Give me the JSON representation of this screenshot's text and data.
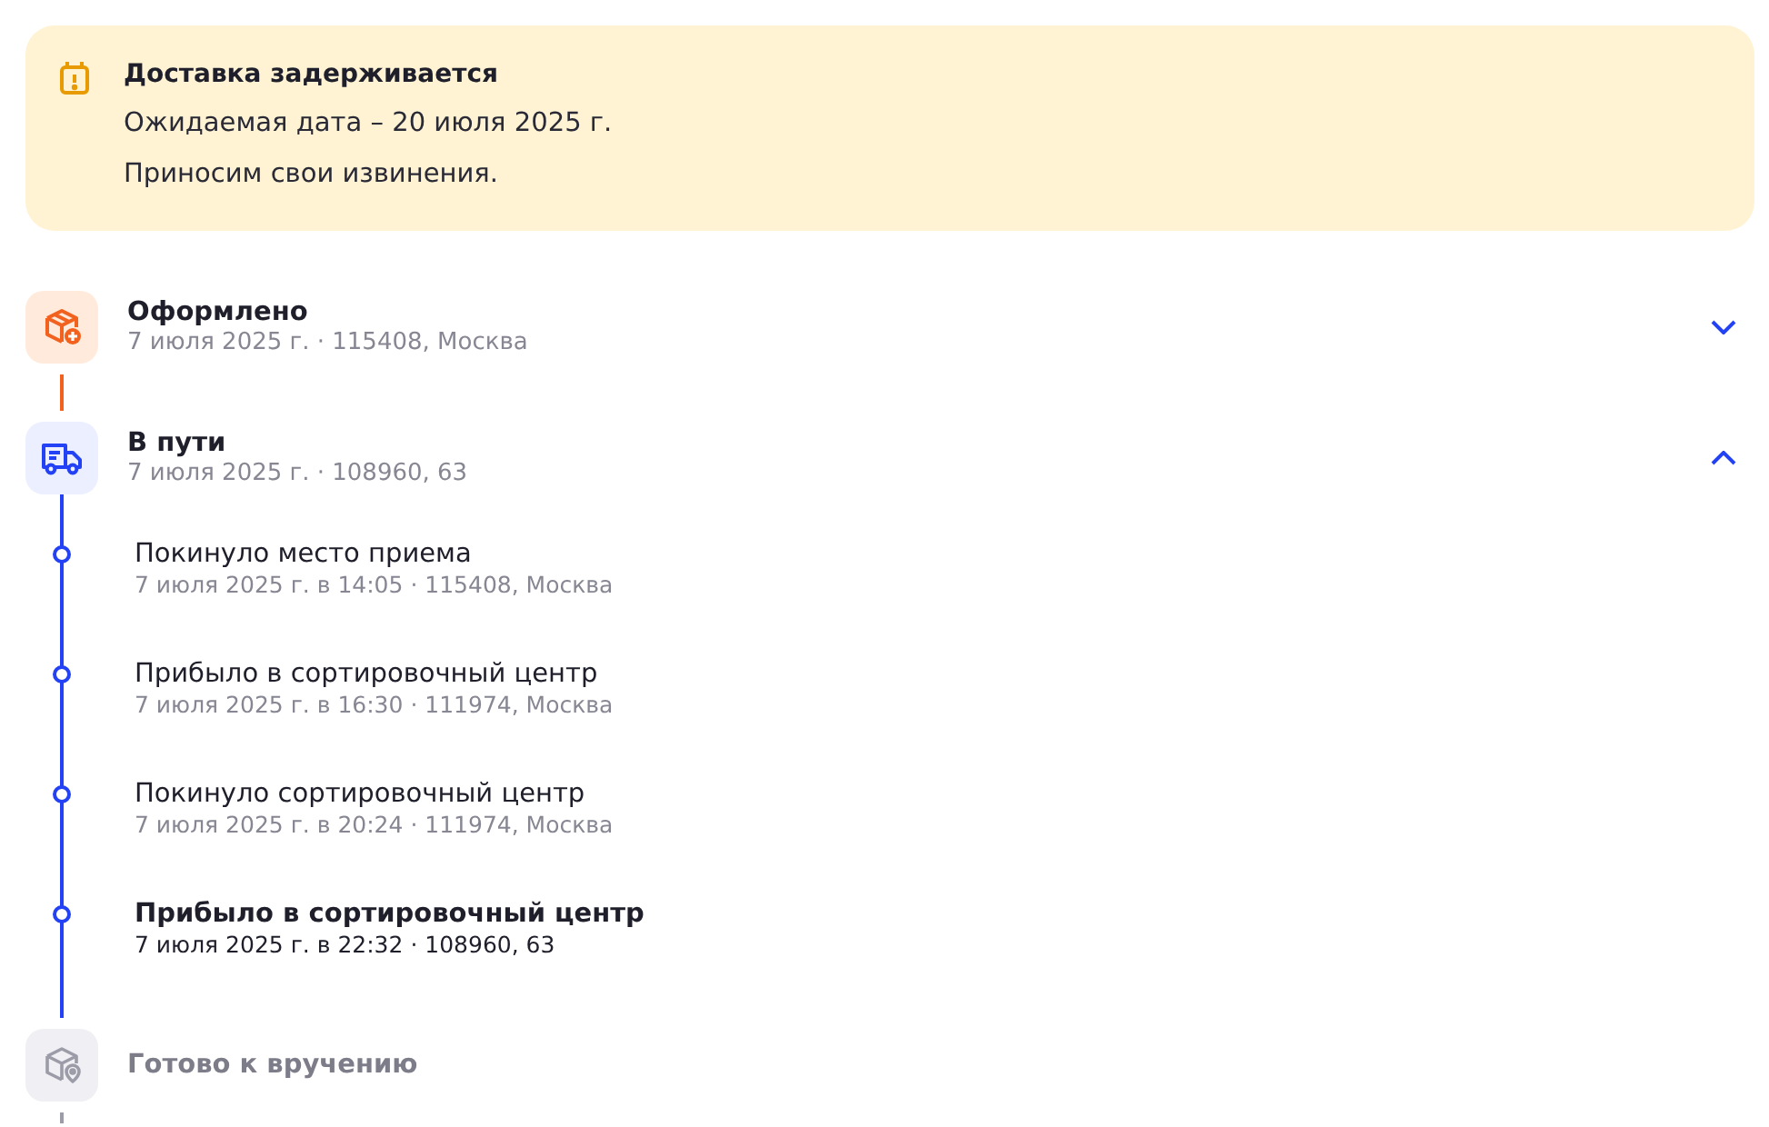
{
  "alert": {
    "title": "Доставка задерживается",
    "lines": [
      "Ожидаемая дата – 20 июля 2025 г.",
      "Приносим свои извинения."
    ]
  },
  "steps": [
    {
      "kind": "placed",
      "done": true,
      "active": false,
      "title": "Оформлено",
      "subtitle": "7 июля 2025 г. · 115408, Москва",
      "expanded": false
    },
    {
      "kind": "transit",
      "done": false,
      "active": true,
      "title": "В пути",
      "subtitle": "7 июля 2025 г. · 108960, 63",
      "expanded": true,
      "events": [
        {
          "title": "Покинуло место приема",
          "subtitle": "7 июля 2025 г. в 14:05 · 115408, Москва",
          "current": false
        },
        {
          "title": "Прибыло в сортировочный центр",
          "subtitle": "7 июля 2025 г. в 16:30 · 111974, Москва",
          "current": false
        },
        {
          "title": "Покинуло сортировочный центр",
          "subtitle": "7 июля 2025 г. в 20:24 · 111974, Москва",
          "current": false
        },
        {
          "title": "Прибыло в сортировочный центр",
          "subtitle": "7 июля 2025 г. в 22:32 · 108960, 63",
          "current": true
        }
      ]
    },
    {
      "kind": "ready",
      "done": false,
      "active": false,
      "title": "Готово к вручению"
    }
  ]
}
